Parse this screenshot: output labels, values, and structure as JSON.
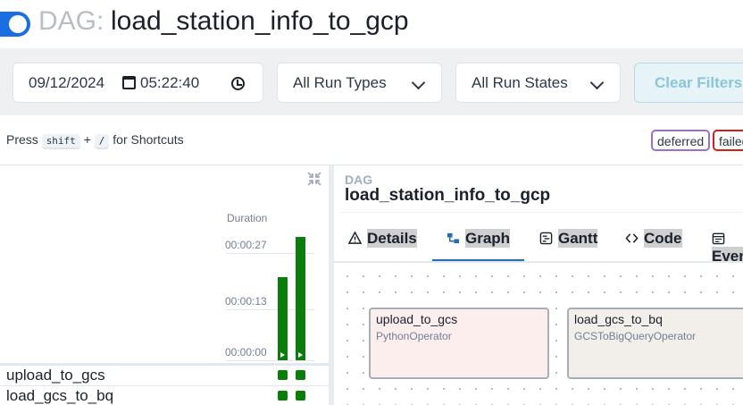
{
  "header": {
    "dag_prefix": "DAG:",
    "dag_id": "load_station_info_to_gcp",
    "paused_toggle_on": true,
    "accent_color": "#1a6fe0"
  },
  "filters": {
    "date": "09/12/2024",
    "time": "05:22:40",
    "run_types": "All Run Types",
    "run_states": "All Run States",
    "clear_label": "Clear Filters"
  },
  "shortcuts": {
    "press": "Press",
    "key1": "shift",
    "plus": "+",
    "key2": "/",
    "suffix": "for Shortcuts"
  },
  "legend": {
    "deferred": "deferred",
    "failed": "failed"
  },
  "grid": {
    "duration_label": "Duration",
    "ticks": [
      "00:00:27",
      "00:00:13",
      "00:00:00"
    ],
    "runs": [
      {
        "duration_sec": 21,
        "state": "success"
      },
      {
        "duration_sec": 31,
        "state": "success"
      }
    ],
    "success_color": "#0a7d0a",
    "tasks": [
      "upload_to_gcs",
      "load_gcs_to_bq"
    ]
  },
  "details_panel": {
    "label": "DAG",
    "dag_id": "load_station_info_to_gcp",
    "tabs": [
      "Details",
      "Graph",
      "Gantt",
      "Code",
      "Events"
    ],
    "active_tab": "Graph"
  },
  "graph": {
    "nodes": [
      {
        "name": "upload_to_gcs",
        "operator": "PythonOperator"
      },
      {
        "name": "load_gcs_to_bq",
        "operator": "GCSToBigQueryOperator"
      }
    ]
  }
}
